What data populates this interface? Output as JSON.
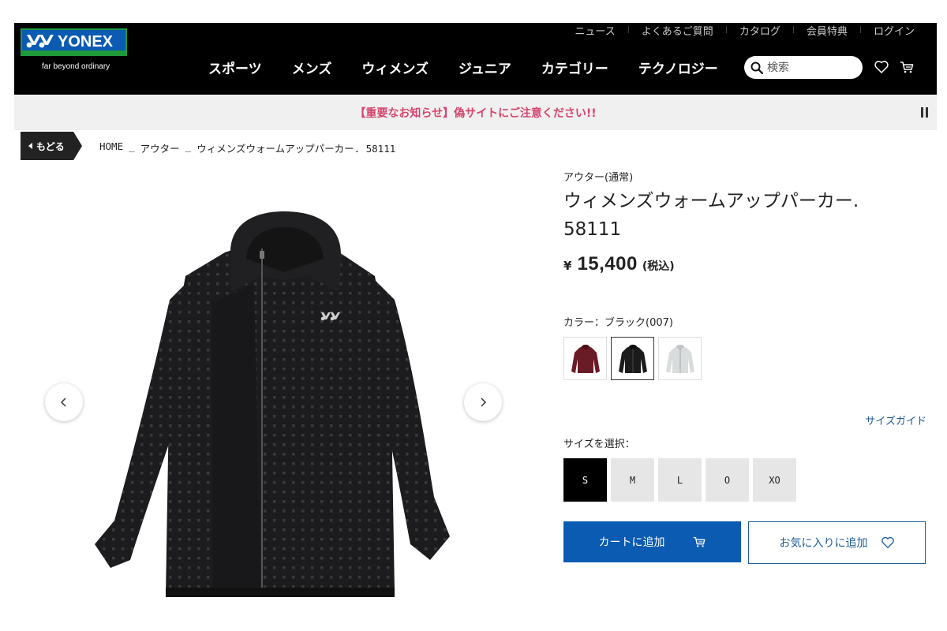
{
  "header": {
    "logo_text": "YONEX",
    "tagline": "far beyond ordinary",
    "utility_links": [
      "ニュース",
      "よくあるご質問",
      "カタログ",
      "会員特典",
      "ログイン"
    ],
    "nav": [
      "スポーツ",
      "メンズ",
      "ウィメンズ",
      "ジュニア",
      "カテゴリー",
      "テクノロジー"
    ],
    "search_placeholder": "検索"
  },
  "notice": {
    "text": "【重要なお知らせ】偽サイトにご注意ください!!"
  },
  "breadcrumb": {
    "back_label": "もどる",
    "items": [
      "HOME",
      "アウター",
      "ウィメンズウォームアップパーカー. 58111"
    ],
    "separator": "_"
  },
  "product": {
    "category": "アウター(通常)",
    "title_line1": "ウィメンズウォームアップパーカー.",
    "title_line2": "58111",
    "price_currency": "¥",
    "price_amount": "15,400",
    "price_tax": "(税込)",
    "color_label": "カラー：ブラック(007)",
    "colors": [
      {
        "name": "wine",
        "hex": "#6b1b26"
      },
      {
        "name": "black",
        "hex": "#1b1b1b"
      },
      {
        "name": "light-gray",
        "hex": "#d9dcdc"
      }
    ],
    "selected_color_index": 1,
    "size_guide_label": "サイズガイド",
    "size_label": "サイズを選択：",
    "sizes": [
      "S",
      "M",
      "L",
      "O",
      "XO"
    ],
    "selected_size_index": 0,
    "add_to_cart_label": "カートに追加",
    "add_to_favorites_label": "お気に入りに追加"
  },
  "colors": {
    "header_bg": "#000000",
    "notice_text": "#d4456e",
    "primary_blue": "#0a5bb1",
    "link_blue": "#1f5b9a",
    "logo_green": "#1f9a3b",
    "logo_blue": "#0a5bb1"
  }
}
